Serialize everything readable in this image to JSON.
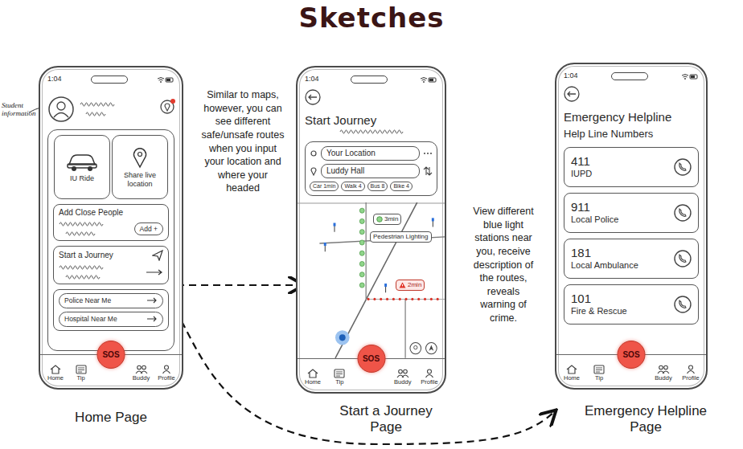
{
  "title": "Sketches",
  "annotations": {
    "student_info": "Student information",
    "journey_note": "Similar to maps, however, you can see different safe/unsafe routes when you input your location and where your headed",
    "map_note": "View different blue light stations near you, receive description of the routes, reveals warning of crime."
  },
  "home": {
    "label": "Home Page",
    "time": "1:04",
    "has_notification": true,
    "tiles": [
      {
        "label": "IU Ride"
      },
      {
        "label": "Share live location"
      }
    ],
    "close_people": {
      "title": "Add Close People",
      "button": "Add +"
    },
    "journey": {
      "title": "Start a Journey"
    },
    "links": [
      "Police Near Me",
      "Hospital Near Me"
    ],
    "sos": "SOS",
    "tab_bar": [
      "Home",
      "Tip",
      "Buddy",
      "Profile"
    ]
  },
  "journey": {
    "label": "Start a Journey Page",
    "time": "1:04",
    "title": "Start Journey",
    "from": "Your Location",
    "to": "Luddy Hall",
    "modes": [
      "Car 1min",
      "Walk 4",
      "Bus 8",
      "Bike 4"
    ],
    "map_labels": [
      {
        "text": "3min",
        "kind": "time"
      },
      {
        "text": "Pedestrian Lighting",
        "kind": "note"
      },
      {
        "text": "2min",
        "kind": "warning"
      }
    ],
    "sos": "SOS",
    "tab_bar": [
      "Home",
      "Tip",
      "Buddy",
      "Profile"
    ]
  },
  "emergency": {
    "label": "Emergency Helpline Page",
    "time": "1:04",
    "title": "Emergency Helpline",
    "subtitle": "Help Line Numbers",
    "numbers": [
      {
        "number": "411",
        "name": "IUPD"
      },
      {
        "number": "911",
        "name": "Local Police"
      },
      {
        "number": "181",
        "name": "Local Ambulance"
      },
      {
        "number": "101",
        "name": "Fire & Rescue"
      }
    ],
    "sos": "SOS",
    "tab_bar": [
      "Home",
      "Tip",
      "Buddy",
      "Profile"
    ]
  }
}
